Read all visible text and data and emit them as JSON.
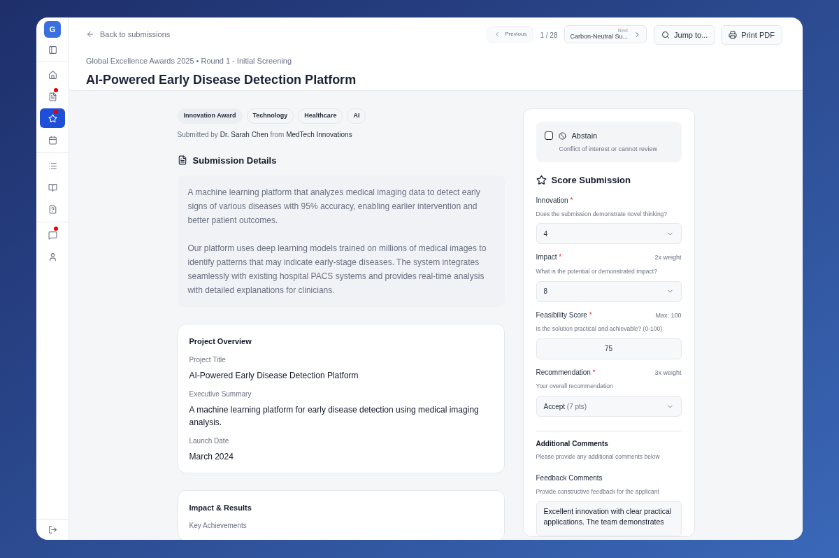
{
  "sidebar": {
    "avatar": "G",
    "sections": [
      [
        {
          "selected": false,
          "badge": false
        },
        {
          "selected": false,
          "badge": true
        },
        {
          "selected": true,
          "badge": true
        },
        {
          "selected": false,
          "badge": false
        }
      ],
      [
        {
          "selected": false,
          "badge": false
        },
        {
          "selected": false,
          "badge": false
        },
        {
          "selected": false,
          "badge": false
        }
      ],
      [
        {
          "selected": false,
          "badge": true
        },
        {
          "selected": false,
          "badge": false
        }
      ]
    ]
  },
  "header": {
    "back": "Back to submissions",
    "breadcrumb": "Global Excellence Awards 2025 • Round 1 - Initial Screening",
    "title": "AI-Powered Early Disease Detection Platform",
    "previous": {
      "label": "Previous",
      "disabled": true
    },
    "position": "1 / 28",
    "next": {
      "label": "Next",
      "title": "Carbon-Neutral Su..."
    },
    "jump": "Jump to...",
    "print": "Print PDF"
  },
  "tags": [
    {
      "label": "Innovation Award",
      "kind": "award"
    },
    {
      "label": "Technology",
      "kind": "tag"
    },
    {
      "label": "Healthcare",
      "kind": "tag"
    },
    {
      "label": "AI",
      "kind": "tag"
    }
  ],
  "submitted": {
    "prefix": "Submitted by",
    "name": "Dr. Sarah Chen",
    "connector": "from",
    "org": "MedTech Innovations"
  },
  "details": {
    "heading": "Submission Details",
    "paragraphs": [
      "A machine learning platform that analyzes medical imaging data to detect early signs of various diseases with 95% accuracy, enabling earlier intervention and better patient outcomes.",
      "Our platform uses deep learning models trained on millions of medical images to identify patterns that may indicate early-stage diseases. The system integrates seamlessly with existing hospital PACS systems and provides real-time analysis with detailed explanations for clinicians."
    ]
  },
  "cards": [
    {
      "title": "Project Overview",
      "fields": [
        {
          "label": "Project Title",
          "value": "AI-Powered Early Disease Detection Platform"
        },
        {
          "label": "Executive Summary",
          "value": "A machine learning platform for early disease detection using medical imaging analysis."
        },
        {
          "label": "Launch Date",
          "value": "March 2024"
        }
      ]
    },
    {
      "title": "Impact & Results",
      "fields": [
        {
          "label": "Key Achievements"
        }
      ]
    }
  ],
  "abstain": {
    "label": "Abstain",
    "hint": "Conflict of interest or cannot review",
    "checked": false
  },
  "scoring": {
    "heading": "Score Submission",
    "criteria": [
      {
        "kind": "select",
        "label": "Innovation",
        "required": "*",
        "hint": "Does the submission demonstrate novel thinking?",
        "value": "4"
      },
      {
        "kind": "select",
        "label": "Impact",
        "required": "*",
        "note": "2x weight",
        "hint": "What is the potential or demonstrated impact?",
        "value": "8"
      },
      {
        "kind": "number",
        "label": "Feasibility Score",
        "required": "*",
        "note": "Max: 100",
        "hint": "Is the solution practical and achievable? (0-100)",
        "value": "75"
      },
      {
        "kind": "select",
        "label": "Recommendation",
        "required": "*",
        "note": "3x weight",
        "hint": "Your overall recommendation",
        "value": "Accept",
        "value_note": "(7 pts)"
      }
    ]
  },
  "comments": {
    "heading": "Additional Comments",
    "hint": "Please provide any additional comments below",
    "feedback_label": "Feedback Comments",
    "feedback_hint": "Provide constructive feedback for the applicant",
    "feedback_value": "Excellent innovation with clear practical applications. The team demonstrates"
  }
}
